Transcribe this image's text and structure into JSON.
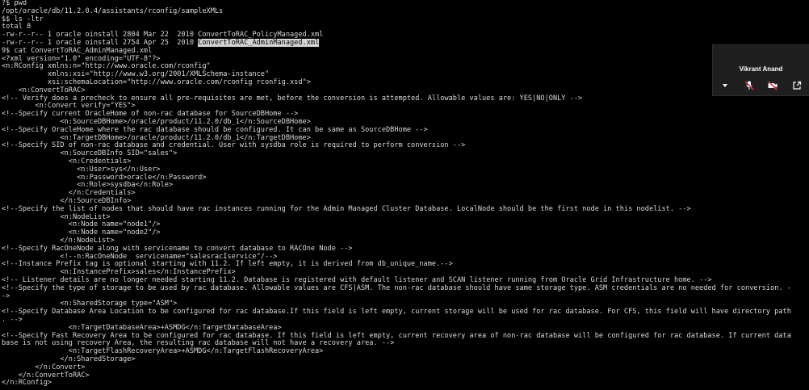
{
  "terminal": {
    "lines": [
      "?$ pwd",
      "/opt/oracle/db/11.2.0.4/assistants/rconfig/sampleXMLs",
      "$$ ls -ltr",
      "total 8",
      "-rw-r--r-- 1 oracle oinstall 2804 Mar 22  2010 ConvertToRAC_PolicyManaged.xml",
      "-rw-r--r-- 1 oracle oinstall 2754 Apr 25  2010 ",
      "9$ cat ConvertToRAC_AdminManaged.xml",
      "<?xml version=\"1.0\" encoding=\"UTF-8\"?>",
      "<n:RConfig xmlns:n=\"http://www.oracle.com/rconfig\"",
      "           xmlns:xsi=\"http://www.w3.org/2001/XMLSchema-instance\"",
      "           xsi:schemaLocation=\"http://www.oracle.com/rconfig rconfig.xsd\">",
      "    <n:ConvertToRAC>",
      "<!-- Verify does a precheck to ensure all pre-requisites are met, before the conversion is attempted. Allowable values are: YES|NO|ONLY -->",
      "        <n:Convert verify=\"YES\">",
      "<!--Specify current OracleHome of non-rac database for SourceDBHome -->",
      "              <n:SourceDBHome>/oracle/product/11.2.0/db_1</n:SourceDBHome>",
      "<!--Specify OracleHome where the rac database should be configured. It can be same as SourceDBHome -->",
      "              <n:TargetDBHome>/oracle/product/11.2.0/db_1</n:TargetDBHome>",
      "<!--Specify SID of non-rac database and credential. User with sysdba role is required to perform conversion -->",
      "              <n:SourceDBInfo SID=\"sales\">",
      "                <n:Credentials>",
      "                  <n:User>sys</n:User>",
      "                  <n:Password>oracle</n:Password>",
      "                  <n:Role>sysdba</n:Role>",
      "                </n:Credentials>",
      "              </n:SourceDBInfo>",
      "<!--Specify the list of nodes that should have rac instances running for the Admin Managed Cluster Database. LocalNode should be the first node in this nodelist. -->",
      "              <n:NodeList>",
      "                <n:Node name=\"node1\"/>",
      "                <n:Node name=\"node2\"/>",
      "              </n:NodeList>",
      "<!--Specify RacOneNode along with servicename to convert database to RACOne Node -->",
      "              <!--n:RacOneNode  servicename=\"salesracIservice\"/-->",
      "<!--Instance Prefix tag is optional starting with 11.2. If left empty, it is derived from db_unique_name.-->",
      "              <n:InstancePrefix>sales</n:InstancePrefix>",
      "<!-- Listener details are no longer needed starting 11.2. Database is registered with default listener and SCAN listener running from Oracle Grid Infrastructure home. -->",
      "<!--Specify the type of storage to be used by rac database. Allowable values are CFS|ASM. The non-rac database should have same storage type. ASM credentials are no needed for conversion. -",
      "->",
      "              <n:SharedStorage type=\"ASM\">",
      "<!--Specify Database Area Location to be configured for rac database.If this field is left empty, current storage will be used for rac database. For CFS, this field will have directory path",
      ". -->",
      "                <n:TargetDatabaseArea>+ASMDG</n:TargetDatabaseArea>",
      "<!--Specify Fast Recovery Area to be configured for rac database. If this field is left empty, current recovery area of non-rac database will be configured for rac database. If current data",
      "base is not using recovery Area, the resulting rac database will not have a recovery area. -->",
      "                <n:TargetFlashRecoveryArea>+ASMDG</n:TargetFlashRecoveryArea>",
      "              </n:SharedStorage>",
      "        </n:Convert>",
      "    </n:ConvertToRAC>",
      "</n:RConfig>"
    ],
    "selected_text": "ConvertToRAC_AdminManaged.xml"
  },
  "call_overlay": {
    "participant_name": "Vikrant Anand",
    "controls": [
      {
        "icon": "chevron-down-icon"
      },
      {
        "icon": "microphone-muted-icon"
      },
      {
        "icon": "camera-off-icon"
      },
      {
        "icon": "pop-out-icon"
      }
    ]
  },
  "colors": {
    "background": "#000000",
    "text": "#d9d9d9",
    "selection": "#d4d4d4",
    "overlay": "#1f1f1f",
    "mute_accent": "#e0303a"
  }
}
